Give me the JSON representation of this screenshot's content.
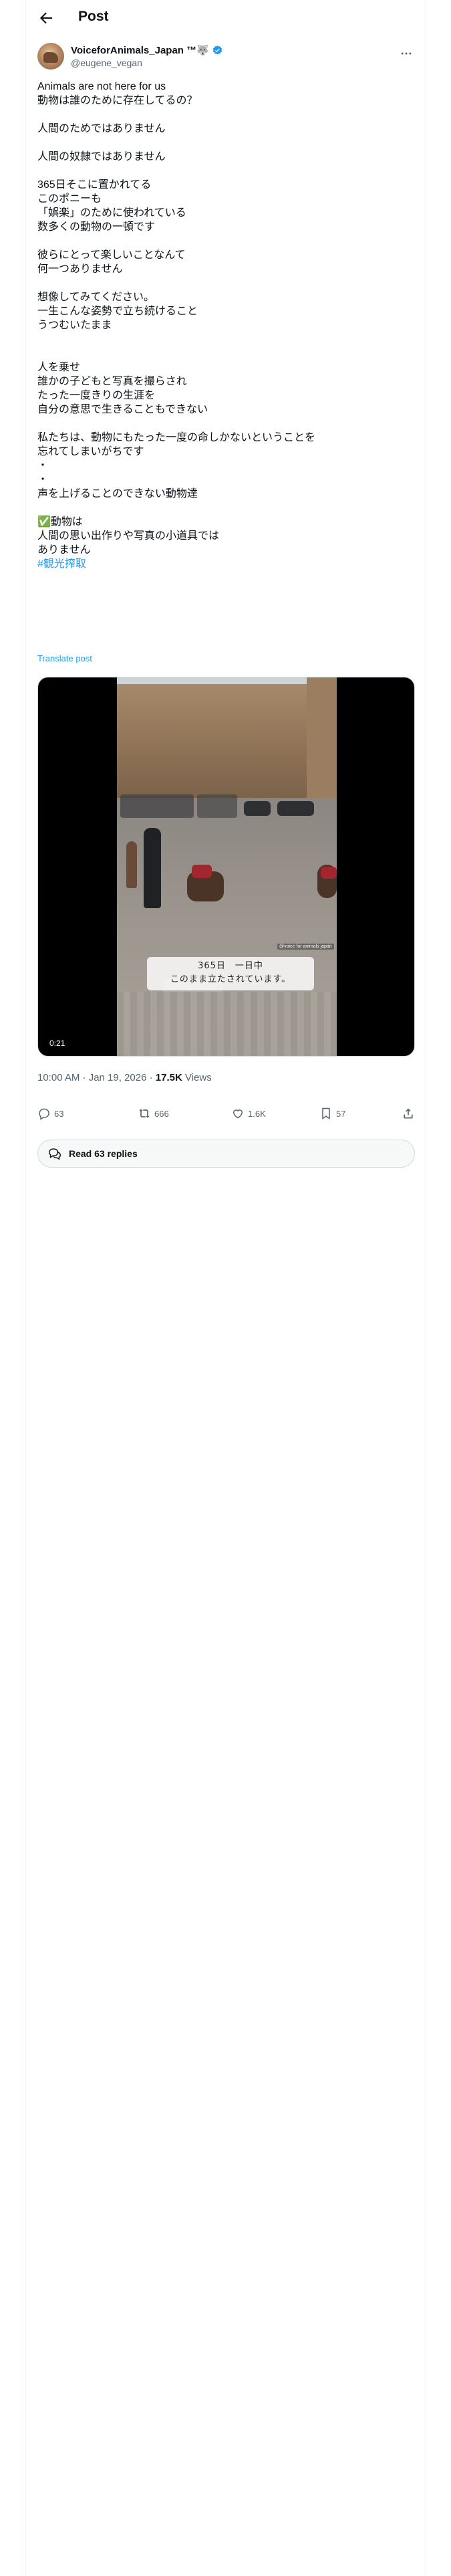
{
  "header": {
    "title": "Post"
  },
  "author": {
    "name": "VoiceforAnimals_Japan ™🐺",
    "handle": "@eugene_vegan",
    "verified": true
  },
  "tweet": {
    "body": "Animals are not here for us\n動物は誰のために存在してるの？\n\n人間のためではありません\n\n人間の奴隷ではありません\n\n365日そこに置かれてる\nこのポニーも\n「娯楽」のために使われている\n数多くの動物の一頓です\n\n彼らにとって楽しいことなんて\n何一つありません\n\n想像してみてください。\n一生こんな姿勢で立ち続けること\nうつむいたまま\n\n\n人を乗せ\n誰かの子どもと写真を撮らされ\nたった一度きりの生涯を\n自分の意思で生きることもできない\n\n私たちは、動物にもたった一度の命しかないということを\n忘れてしまいがちです\n・\n・\n声を上げることのできない動物達\n\n✅動物は\n人間の思い出作りや写真の小道具では\nありません\n",
    "hashtag": "#観光搾取",
    "translate_label": "Translate post"
  },
  "media": {
    "caption_line1": "365日　一日中",
    "caption_line2": "このまま立たされています。",
    "watermark": "@voice for animals japan",
    "duration": "0:21"
  },
  "meta": {
    "timestamp": "10:00 AM · Jan 19, 2026 · ",
    "views_count": "17.5K",
    "views_label": " Views"
  },
  "actions": {
    "replies": "63",
    "reposts": "666",
    "likes": "1.6K",
    "bookmarks": "57"
  },
  "read_replies_label": "Read 63 replies",
  "colors": {
    "accent": "#1d9bf0",
    "muted": "#536471",
    "text": "#0f1419"
  },
  "icons": [
    "back-arrow-icon",
    "verified-badge-icon",
    "more-options-icon",
    "reply-icon",
    "repost-icon",
    "like-icon",
    "bookmark-icon",
    "share-icon",
    "replies-bubble-icon"
  ]
}
